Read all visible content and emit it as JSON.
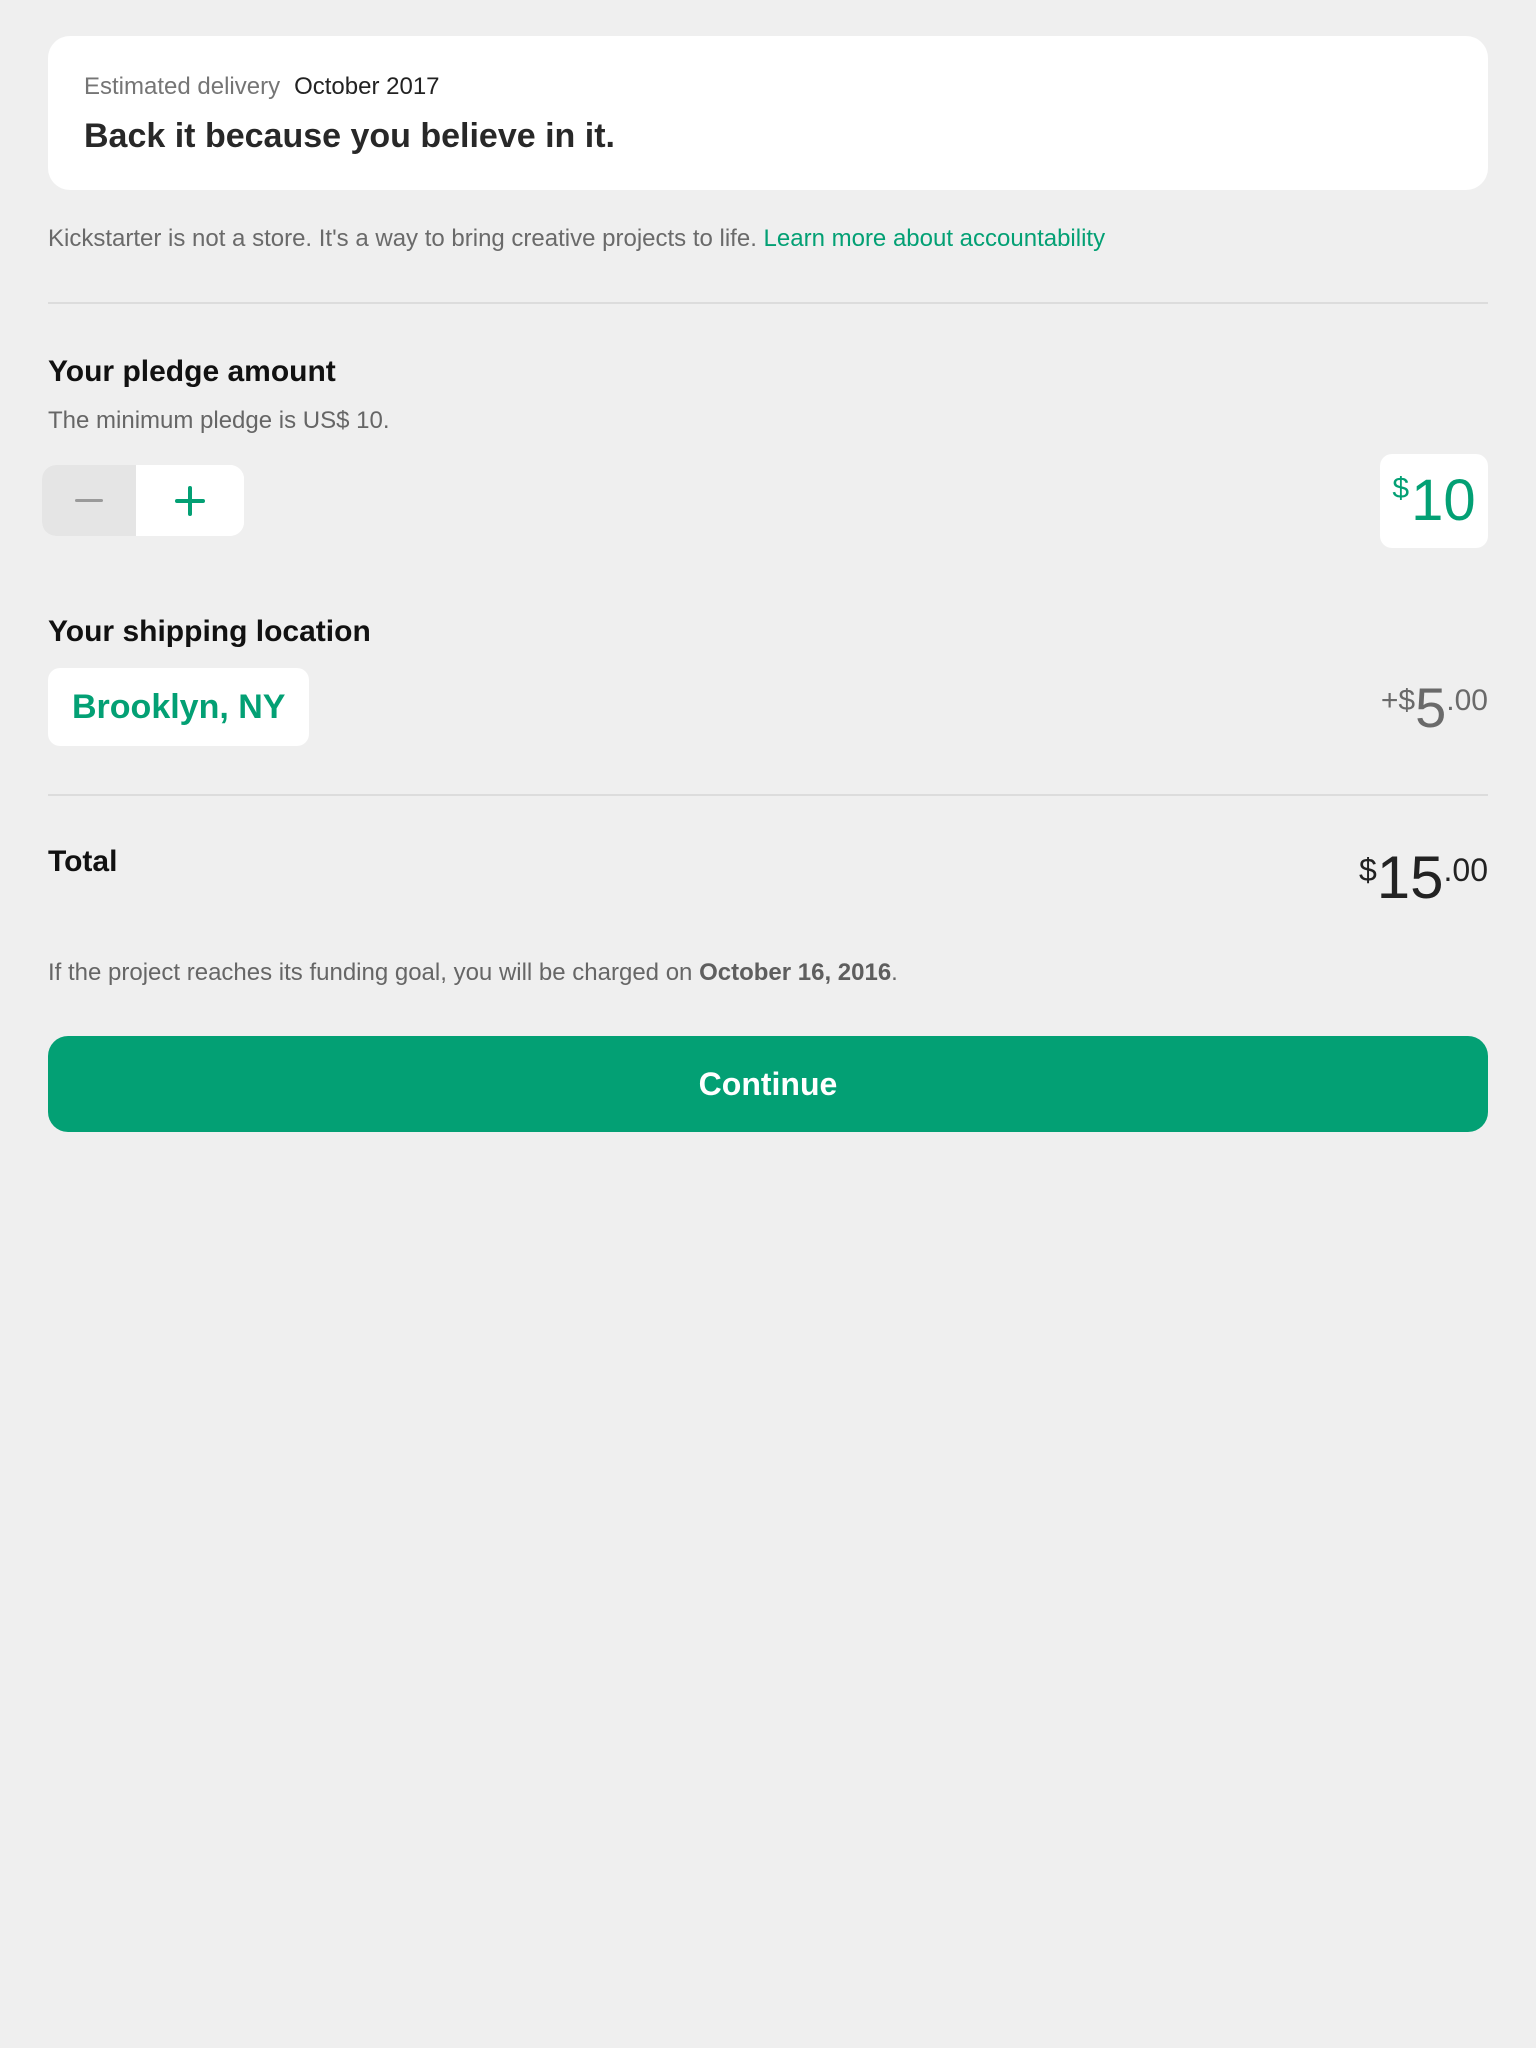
{
  "reward": {
    "delivery_label": "Estimated delivery",
    "delivery_value": "October 2017",
    "title": "Back it because you believe in it."
  },
  "disclaimer": {
    "text": "Kickstarter is not a store. It's a way to bring creative projects to life.",
    "link": "Learn more about accountability"
  },
  "pledge": {
    "title": "Your pledge amount",
    "minimum_text": "The minimum pledge is US$ 10.",
    "decrement_icon": "minus-icon",
    "increment_icon": "plus-icon",
    "currency_symbol": "$",
    "amount": "10"
  },
  "shipping": {
    "title": "Your shipping location",
    "location": "Brooklyn, NY",
    "prefix": "+$",
    "amount_whole": "5",
    "amount_cents": ".00"
  },
  "total": {
    "label": "Total",
    "currency_symbol": "$",
    "amount_whole": "15",
    "amount_cents": ".00"
  },
  "charge_note": {
    "text": "If the project reaches its funding goal, you will be charged on",
    "date": "October 16, 2016",
    "suffix": "."
  },
  "continue_label": "Continue",
  "colors": {
    "accent": "#03a074",
    "background": "#efefef",
    "card": "#ffffff"
  }
}
